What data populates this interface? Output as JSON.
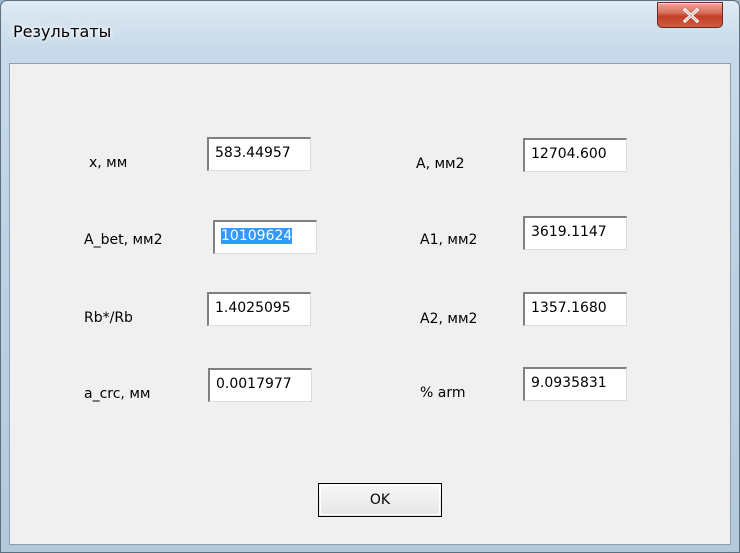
{
  "window": {
    "title": "Результаты"
  },
  "fields": {
    "x": {
      "label": "x, мм",
      "value": "583.44957"
    },
    "a_bet": {
      "label": "A_bet, мм2",
      "value": "10109624"
    },
    "rb_ratio": {
      "label": "Rb*/Rb",
      "value": "1.4025095"
    },
    "a_crc": {
      "label": "a_crc, мм",
      "value": "0.0017977"
    },
    "a": {
      "label": "A, мм2",
      "value": "12704.600"
    },
    "a1": {
      "label": "A1, мм2",
      "value": "3619.1147"
    },
    "a2": {
      "label": "A2, мм2",
      "value": "1357.1680"
    },
    "pct_arm": {
      "label": "% arm",
      "value": "9.0935831"
    }
  },
  "buttons": {
    "ok_label": "OK"
  },
  "icons": {
    "close": "close-icon"
  },
  "colors": {
    "selection": "#3399ff",
    "close_button": "#c2402a"
  }
}
